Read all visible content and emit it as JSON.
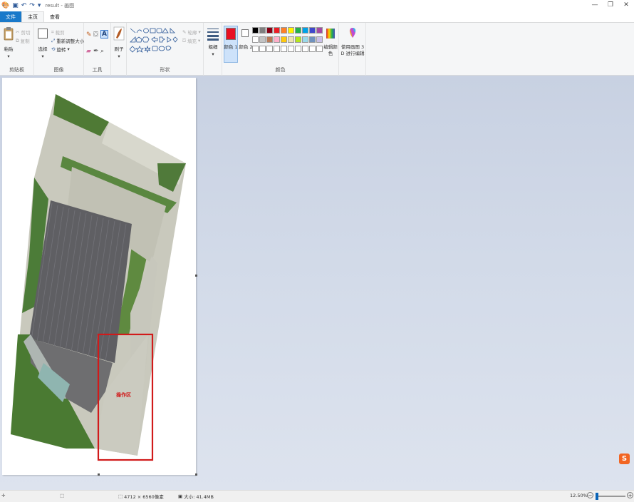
{
  "titlebar": {
    "title": "result - 画图",
    "quick_access": [
      "paint-app-icon",
      "save-icon",
      "undo-icon",
      "redo-icon",
      "dropdown-icon"
    ],
    "window_controls": [
      "—",
      "❐",
      "✕"
    ]
  },
  "tabs": {
    "file": "文件",
    "home": "主页",
    "view": "查看"
  },
  "ribbon": {
    "clipboard": {
      "label": "剪贴板",
      "paste": "粘贴",
      "cut": "剪切",
      "copy": "复制"
    },
    "image": {
      "label": "图像",
      "select": "选择",
      "crop": "裁剪",
      "resize": "重新调整大小",
      "rotate": "旋转"
    },
    "tools": {
      "label": "工具"
    },
    "brushes": {
      "label": "刷子"
    },
    "shapes": {
      "label": "形状",
      "outline": "轮廓",
      "fill": "填充"
    },
    "size": {
      "label": "粗细"
    },
    "colors": {
      "label": "颜色",
      "color1": "颜色 1",
      "color2": "颜色 2",
      "edit_colors": "编辑颜色",
      "color1_value": "#e81123",
      "color2_value": "#ffffff",
      "palette_row1": [
        "#000000",
        "#7f7f7f",
        "#880015",
        "#ed1c24",
        "#ff7f27",
        "#fff200",
        "#22b14c",
        "#00a2e8",
        "#3f48cc",
        "#a349a4"
      ],
      "palette_row2": [
        "#ffffff",
        "#c3c3c3",
        "#b97a57",
        "#ffaec9",
        "#ffc90e",
        "#efe4b0",
        "#b5e61d",
        "#99d9ea",
        "#7092be",
        "#c8bfe7"
      ],
      "palette_row3": [
        "#ffffff",
        "#ffffff",
        "#ffffff",
        "#ffffff",
        "#ffffff",
        "#ffffff",
        "#ffffff",
        "#ffffff",
        "#ffffff",
        "#ffffff"
      ]
    },
    "paint3d": {
      "label": "使用画图 3 D 进行编辑"
    }
  },
  "canvas": {
    "annotation_label": "操作区",
    "annotation_color": "#d11a1a"
  },
  "statusbar": {
    "dimensions": "4712 × 6560像素",
    "size": "大小: 41.4MB",
    "zoom": "12.50%"
  }
}
